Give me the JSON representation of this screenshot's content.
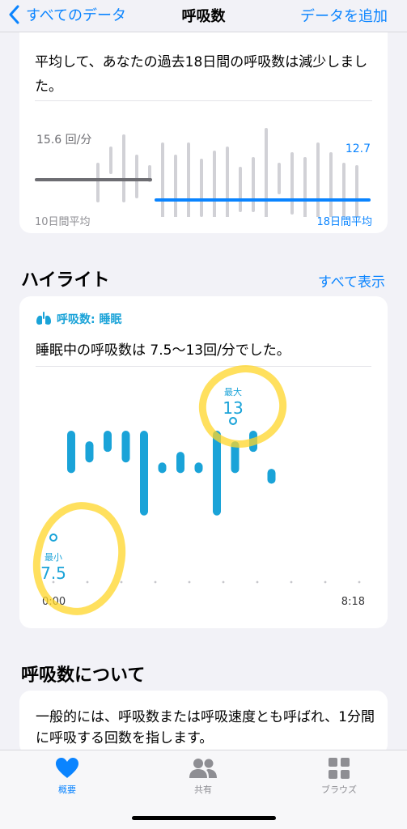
{
  "nav": {
    "back_label": "すべてのデータ",
    "title": "呼吸数",
    "action_label": "データを追加"
  },
  "trend_card": {
    "message": "平均して、あなたの過去18日間の呼吸数は減少しました。",
    "left_value": "15.6 回/分",
    "right_value": "12.7",
    "left_footer": "10日間平均",
    "right_footer": "18日間平均"
  },
  "highlights": {
    "title": "ハイライト",
    "link": "すべて表示",
    "card": {
      "category": "呼吸数: 睡眠",
      "description": "睡眠中の呼吸数は 7.5〜13回/分でした。",
      "max_label": "最大",
      "max_value": "13",
      "min_label": "最小",
      "min_value": "7.5",
      "x_start": "0:00",
      "x_end": "8:18"
    }
  },
  "about": {
    "title": "呼吸数について",
    "text": "一般的には、呼吸数または呼吸速度とも呼ばれ、1分間に呼吸する回数を指します。"
  },
  "tabbar": {
    "tabs": [
      {
        "label": "概要"
      },
      {
        "label": "共有"
      },
      {
        "label": "ブラウズ"
      }
    ]
  },
  "colors": {
    "accent": "#0a84ff",
    "respiratory": "#1aa3d8",
    "gray_bar": "#d1d1d6",
    "highlight": "#ffd628"
  },
  "chart_data": {
    "type": "bar",
    "title": "",
    "xlabel": "",
    "ylabel": "",
    "x_range": [
      "0:00",
      "8:18"
    ],
    "series": [
      {
        "values": [
          {
            "low": 11,
            "high": 13
          },
          {
            "low": 11.5,
            "high": 12.5
          },
          {
            "low": 12,
            "high": 13
          },
          {
            "low": 11.5,
            "high": 13
          },
          {
            "low": 9,
            "high": 13
          },
          {
            "low": 11,
            "high": 11.5
          },
          {
            "low": 11,
            "high": 12
          },
          {
            "low": 11,
            "high": 11.5
          },
          {
            "low": 9,
            "high": 13
          },
          {
            "low": 11,
            "high": 12.5
          },
          {
            "low": 12,
            "high": 13
          },
          {
            "low": 10.5,
            "high": 11.2
          }
        ]
      }
    ],
    "min": 7.5,
    "max": 13
  }
}
